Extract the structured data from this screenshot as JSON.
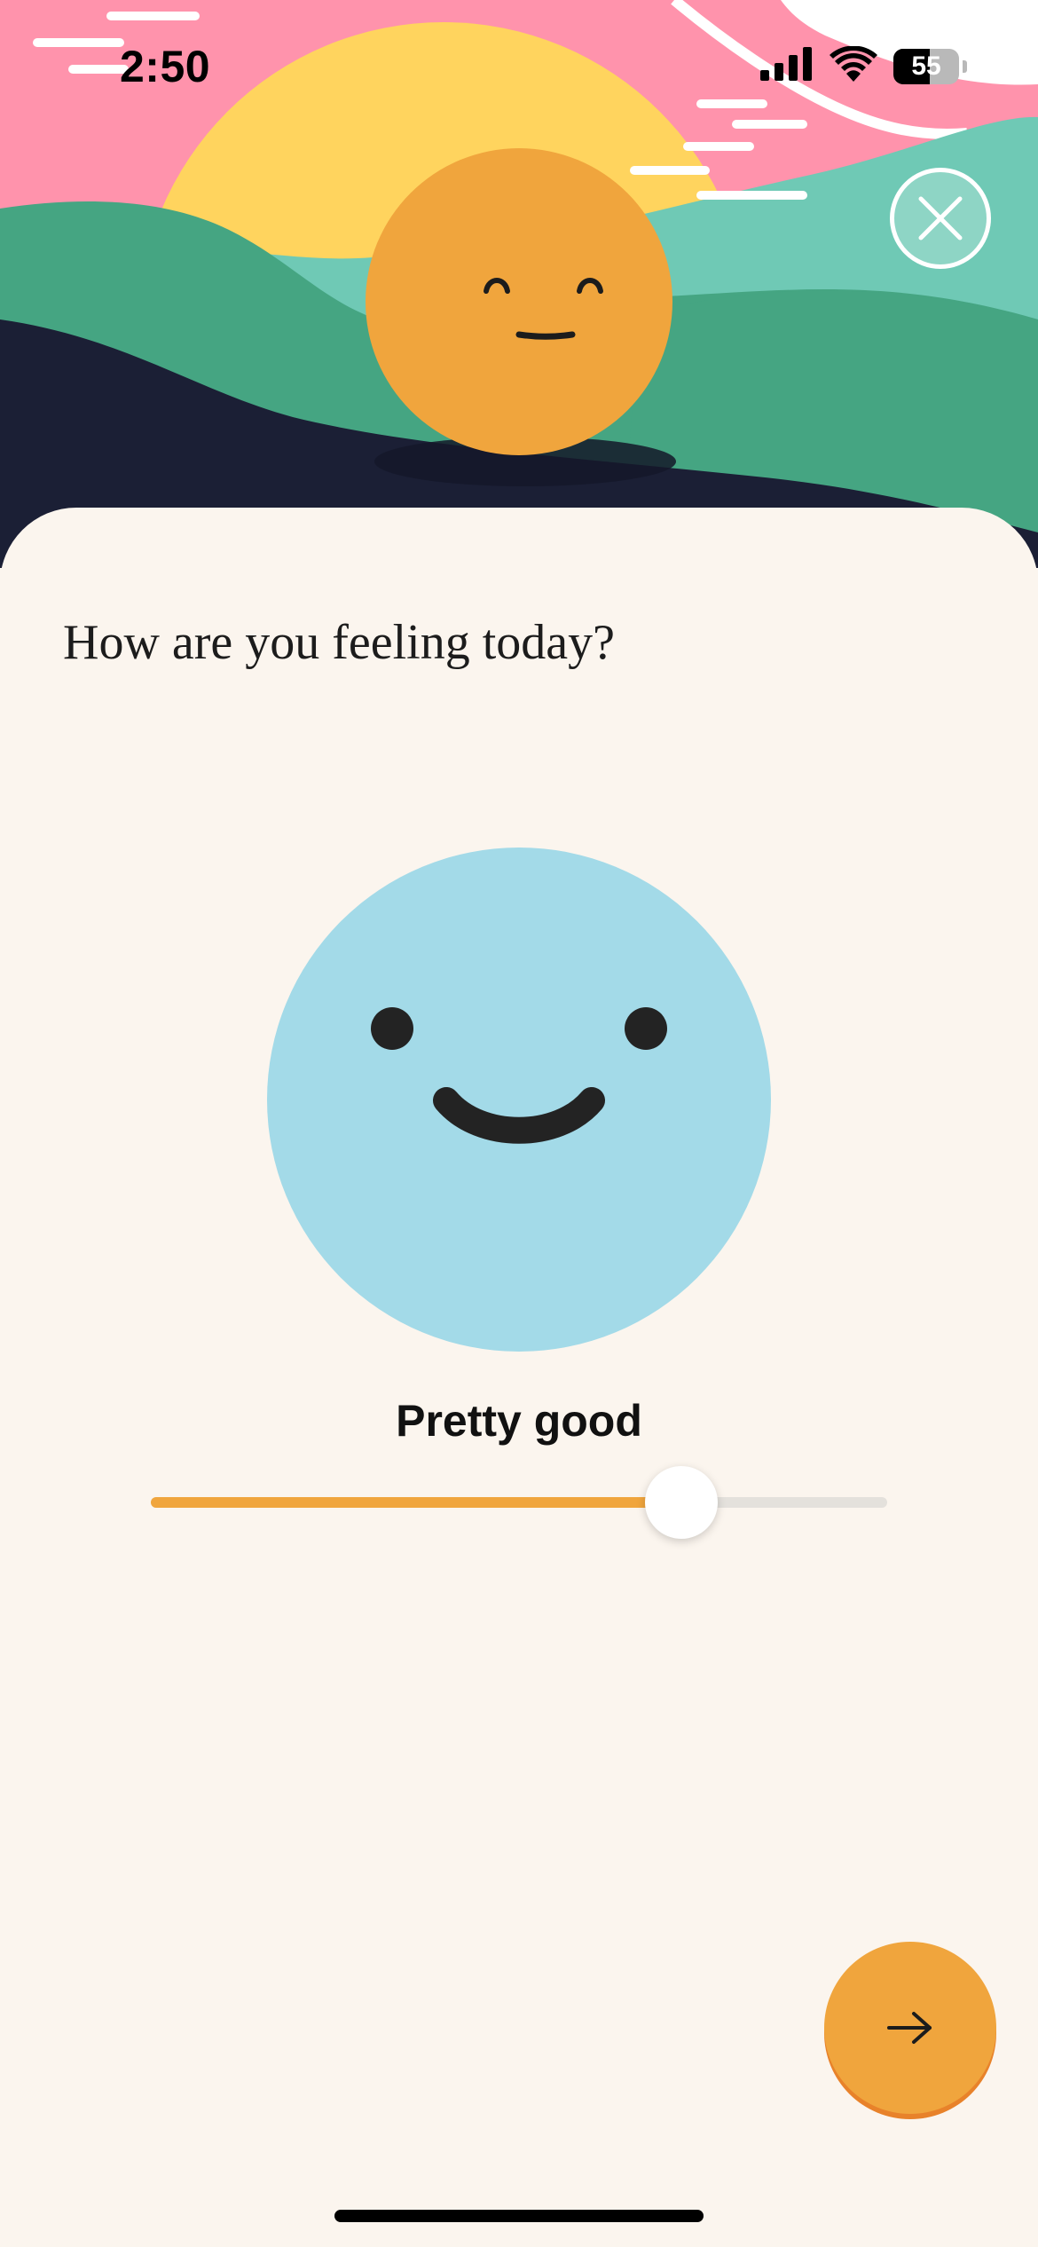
{
  "status_bar": {
    "time": "2:50",
    "battery_level": "55",
    "icons": [
      "signal-icon",
      "wifi-icon",
      "battery-icon"
    ]
  },
  "header": {
    "close_icon": "close-icon"
  },
  "checkin": {
    "question": "How are you feeling today?",
    "mood_label": "Pretty good",
    "mood_slider_value": 0.72,
    "next_icon": "arrow-right-icon"
  },
  "colors": {
    "accent": "#F0A53D",
    "sheet_background": "#FBF5EE",
    "face_blue": "#A3DAE8",
    "sun_yellow": "#FFD45E",
    "sky_pink": "#FF93AC",
    "hill_green": "#45A582",
    "ground_navy": "#1B1F35"
  }
}
